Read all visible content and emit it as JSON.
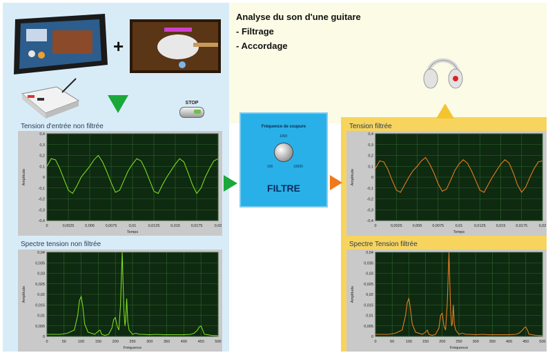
{
  "header": {
    "title": "Analyse du son d'une guitare",
    "item1": "- Filtrage",
    "item2": "- Accordage"
  },
  "controls": {
    "stop_label": "STOP",
    "filter": {
      "knob_title": "Fréquence de coupure",
      "tick_top": "1000",
      "tick_left": "100",
      "tick_right": "10000",
      "label": "FILTRE"
    }
  },
  "colors": {
    "unfiltered": "#7ddc1f",
    "filtered": "#e67e22",
    "plot_bg": "#0e2a10",
    "grid": "#2d6b2d",
    "arrow_green": "#1aa83a",
    "arrow_orange": "#f07a1a",
    "arrow_yellow": "#f4c430"
  },
  "chart_data": [
    {
      "type": "line",
      "title": "Tension d'entrée non filtrée",
      "xlabel": "Temps",
      "ylabel": "Amplitude",
      "xlim": [
        0,
        0.02
      ],
      "ylim": [
        -0.4,
        0.4
      ],
      "xticks": [
        "0",
        "0,0025",
        "0,005",
        "0,0075",
        "0,01",
        "0,0125",
        "0,015",
        "0,0175",
        "0,02"
      ],
      "yticks": [
        "0,4",
        "0,3",
        "0,2",
        "0,1",
        "0",
        "-0,1",
        "-0,2",
        "-0,3",
        "-0,4"
      ],
      "series": [
        {
          "x": [
            0,
            0.0005,
            0.001,
            0.0015,
            0.002,
            0.0025,
            0.003,
            0.0035,
            0.004,
            0.0045,
            0.005,
            0.0055,
            0.006,
            0.0065,
            0.007,
            0.0075,
            0.008,
            0.0085,
            0.009,
            0.0095,
            0.01,
            0.0105,
            0.011,
            0.0115,
            0.012,
            0.0125,
            0.013,
            0.0135,
            0.014,
            0.0145,
            0.015,
            0.0155,
            0.016,
            0.0165,
            0.017,
            0.0175,
            0.018,
            0.0185,
            0.019,
            0.0195,
            0.02
          ],
          "y": [
            0.1,
            0.17,
            0.16,
            0.08,
            -0.02,
            -0.12,
            -0.15,
            -0.08,
            0.0,
            0.05,
            0.1,
            0.16,
            0.2,
            0.14,
            0.05,
            -0.05,
            -0.14,
            -0.12,
            -0.03,
            0.06,
            0.12,
            0.17,
            0.15,
            0.07,
            -0.03,
            -0.13,
            -0.15,
            -0.07,
            0.0,
            0.06,
            0.12,
            0.17,
            0.14,
            0.04,
            -0.07,
            -0.15,
            -0.1,
            0.0,
            0.08,
            0.15,
            0.17
          ]
        }
      ]
    },
    {
      "type": "line",
      "title": "Spectre tension non filtrée",
      "xlabel": "Fréquence",
      "ylabel": "Amplitude",
      "xlim": [
        0,
        500
      ],
      "ylim": [
        0,
        0.04
      ],
      "xticks": [
        "0",
        "50",
        "100",
        "150",
        "200",
        "250",
        "300",
        "350",
        "400",
        "450",
        "500"
      ],
      "yticks": [
        "0,04",
        "0,035",
        "0,03",
        "0,025",
        "0,02",
        "0,015",
        "0,01",
        "0,005",
        "0"
      ],
      "series": [
        {
          "x": [
            0,
            20,
            40,
            60,
            80,
            90,
            95,
            100,
            105,
            110,
            120,
            140,
            150,
            155,
            160,
            170,
            180,
            190,
            195,
            200,
            205,
            210,
            215,
            220,
            222,
            225,
            228,
            230,
            233,
            236,
            240,
            250,
            260,
            270,
            280,
            300,
            320,
            340,
            360,
            380,
            400,
            420,
            430,
            440,
            445,
            450,
            455,
            460,
            470,
            480,
            500
          ],
          "y": [
            0.001,
            0.001,
            0.001,
            0.0015,
            0.003,
            0.01,
            0.017,
            0.019,
            0.014,
            0.006,
            0.002,
            0.001,
            0.0025,
            0.003,
            0.001,
            0.0005,
            0.001,
            0.004,
            0.008,
            0.009,
            0.005,
            0.003,
            0.015,
            0.04,
            0.028,
            0.012,
            0.005,
            0.008,
            0.018,
            0.007,
            0.003,
            0.001,
            0.0015,
            0.001,
            0.001,
            0.0008,
            0.001,
            0.0008,
            0.0008,
            0.0008,
            0.0008,
            0.001,
            0.0015,
            0.003,
            0.0045,
            0.005,
            0.003,
            0.001,
            0.0008,
            0.0005,
            0.0003
          ]
        }
      ]
    },
    {
      "type": "line",
      "title": "Tension filtrée",
      "xlabel": "Temps",
      "ylabel": "Amplitude",
      "xlim": [
        0,
        0.02
      ],
      "ylim": [
        -0.4,
        0.4
      ],
      "xticks": [
        "0",
        "0,0025",
        "0,005",
        "0,0075",
        "0,01",
        "0,0125",
        "0,015",
        "0,0175",
        "0,02"
      ],
      "yticks": [
        "0,4",
        "0,3",
        "0,2",
        "0,1",
        "0",
        "-0,1",
        "-0,2",
        "-0,3",
        "-0,4"
      ],
      "series": [
        {
          "x": [
            0,
            0.0005,
            0.001,
            0.0015,
            0.002,
            0.0025,
            0.003,
            0.0035,
            0.004,
            0.0045,
            0.005,
            0.0055,
            0.006,
            0.0065,
            0.007,
            0.0075,
            0.008,
            0.0085,
            0.009,
            0.0095,
            0.01,
            0.0105,
            0.011,
            0.0115,
            0.012,
            0.0125,
            0.013,
            0.0135,
            0.014,
            0.0145,
            0.015,
            0.0155,
            0.016,
            0.0165,
            0.017,
            0.0175,
            0.018,
            0.0185,
            0.019,
            0.0195,
            0.02
          ],
          "y": [
            0.08,
            0.15,
            0.14,
            0.07,
            -0.03,
            -0.12,
            -0.14,
            -0.07,
            0.0,
            0.06,
            0.1,
            0.15,
            0.18,
            0.12,
            0.04,
            -0.06,
            -0.13,
            -0.11,
            -0.03,
            0.06,
            0.12,
            0.16,
            0.13,
            0.06,
            -0.03,
            -0.12,
            -0.14,
            -0.07,
            0.0,
            0.06,
            0.12,
            0.16,
            0.13,
            0.04,
            -0.07,
            -0.14,
            -0.09,
            0.0,
            0.08,
            0.14,
            0.15
          ]
        }
      ]
    },
    {
      "type": "line",
      "title": "Spectre Tension filtrée",
      "xlabel": "Fréquence",
      "ylabel": "Amplitude",
      "xlim": [
        0,
        500
      ],
      "ylim": [
        0,
        0.04
      ],
      "xticks": [
        "0",
        "50",
        "100",
        "150",
        "200",
        "250",
        "300",
        "350",
        "400",
        "450",
        "500"
      ],
      "yticks": [
        "0,04",
        "0,035",
        "0,03",
        "0,025",
        "0,02",
        "0,015",
        "0,01",
        "0,005",
        "0"
      ],
      "series": [
        {
          "x": [
            0,
            20,
            40,
            60,
            80,
            90,
            95,
            100,
            105,
            110,
            120,
            140,
            150,
            155,
            160,
            170,
            180,
            190,
            195,
            200,
            205,
            210,
            215,
            220,
            222,
            225,
            228,
            230,
            233,
            236,
            240,
            250,
            260,
            270,
            280,
            300,
            320,
            340,
            360,
            380,
            400,
            420,
            430,
            440,
            445,
            450,
            455,
            460,
            470,
            480,
            500
          ],
          "y": [
            0.001,
            0.001,
            0.001,
            0.0015,
            0.003,
            0.01,
            0.016,
            0.018,
            0.013,
            0.006,
            0.002,
            0.001,
            0.002,
            0.003,
            0.001,
            0.0005,
            0.001,
            0.004,
            0.01,
            0.011,
            0.005,
            0.003,
            0.016,
            0.04,
            0.03,
            0.012,
            0.005,
            0.006,
            0.015,
            0.006,
            0.003,
            0.001,
            0.0015,
            0.001,
            0.001,
            0.0008,
            0.001,
            0.0008,
            0.0008,
            0.0008,
            0.0008,
            0.001,
            0.0015,
            0.003,
            0.004,
            0.0045,
            0.003,
            0.001,
            0.0008,
            0.0005,
            0.0003
          ]
        }
      ]
    }
  ]
}
